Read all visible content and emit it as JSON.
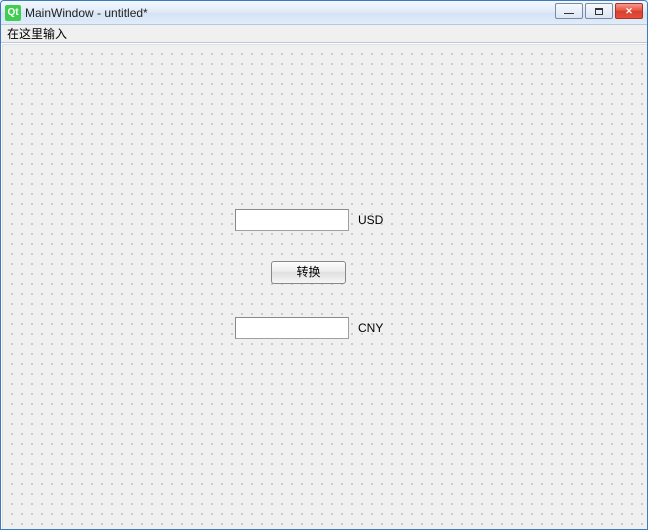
{
  "window": {
    "title": "MainWindow - untitled*",
    "icon_text": "Qt"
  },
  "menubar": {
    "item": "在这里输入"
  },
  "form": {
    "usd_value": "",
    "usd_label": "USD",
    "convert_label": "转换",
    "cny_value": "",
    "cny_label": "CNY"
  }
}
